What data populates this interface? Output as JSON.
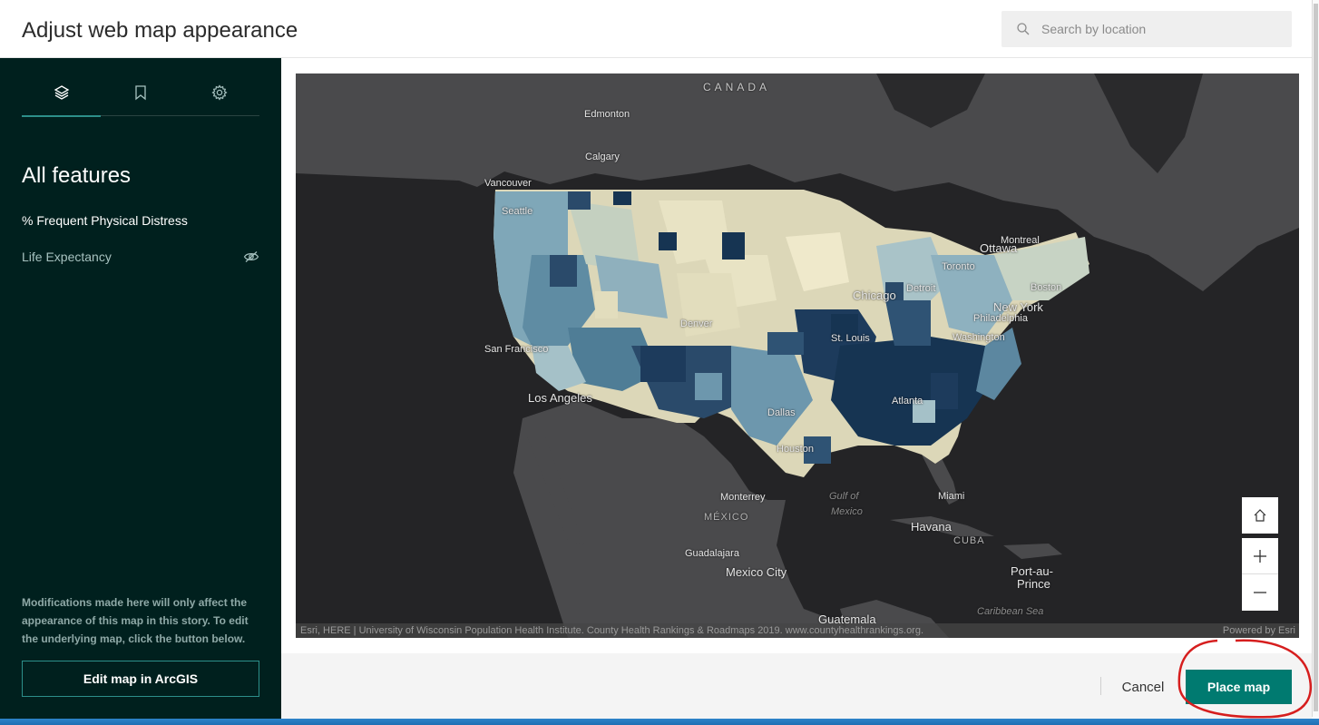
{
  "header": {
    "title": "Adjust web map appearance",
    "search": {
      "placeholder": "Search by location",
      "icon": "search-icon"
    }
  },
  "sidebar": {
    "tabs": [
      {
        "icon": "layers-icon",
        "active": true
      },
      {
        "icon": "bookmark-icon",
        "active": false
      },
      {
        "icon": "gear-icon",
        "active": false
      }
    ],
    "section_title": "All features",
    "layers": [
      {
        "label": "% Frequent Physical Distress",
        "visible": true
      },
      {
        "label": "Life Expectancy",
        "visible": false,
        "icon": "eye-off-icon"
      }
    ],
    "note": "Modifications made here will only affect the appearance of this map in this story. To edit the underlying map, click the button below.",
    "edit_button": "Edit map in ArcGIS"
  },
  "map": {
    "labels": {
      "canada": "CANADA",
      "edmonton": "Edmonton",
      "calgary": "Calgary",
      "vancouver": "Vancouver",
      "seattle": "Seattle",
      "montreal": "Montreal",
      "ottawa": "Ottawa",
      "toronto": "Toronto",
      "detroit": "Detroit",
      "chicago": "Chicago",
      "boston": "Boston",
      "new_york": "New York",
      "philadelphia": "Philadelphia",
      "washington": "Washington",
      "denver": "Denver",
      "st_louis": "St. Louis",
      "san_francisco": "San Francisco",
      "los_angeles": "Los Angeles",
      "atlanta": "Atlanta",
      "dallas": "Dallas",
      "houston": "Houston",
      "monterrey": "Monterrey",
      "mexico": "MÉXICO",
      "gulf_of_mexico_1": "Gulf of",
      "gulf_of_mexico_2": "Mexico",
      "miami": "Miami",
      "havana": "Havana",
      "cuba": "CUBA",
      "guadalajara": "Guadalajara",
      "mexico_city": "Mexico City",
      "port_au_prince_1": "Port-au-",
      "port_au_prince_2": "Prince",
      "caribbean_sea": "Caribbean Sea",
      "guatemala": "Guatemala"
    },
    "attribution": "Esri, HERE | University of Wisconsin Population Health Institute. County Health Rankings & Roadmaps 2019. www.countyhealthrankings.org.",
    "powered_by": "Powered by Esri",
    "controls": [
      {
        "icon": "home-icon"
      },
      {
        "icon": "plus-icon"
      },
      {
        "icon": "minus-icon"
      }
    ],
    "colors": {
      "land": "#4a4a4c",
      "water": "#242426",
      "low": "#e8e3c4",
      "mid": "#7fa7b8",
      "high": "#163452"
    }
  },
  "footer": {
    "cancel_button": "Cancel",
    "place_button": "Place map"
  }
}
